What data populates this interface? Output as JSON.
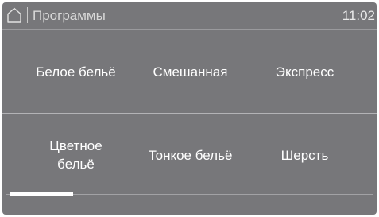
{
  "header": {
    "title": "Программы",
    "clock": "11:02",
    "home_icon": "home-icon"
  },
  "programs": [
    {
      "label": "Белое бельё"
    },
    {
      "label": "Смешанная"
    },
    {
      "label": "Экспресс"
    },
    {
      "label": "Цветное бельё"
    },
    {
      "label": "Тонкое бельё"
    },
    {
      "label": "Шерсть"
    }
  ],
  "scroll": {
    "page_fraction": 0.17
  },
  "colors": {
    "background": "#77777a",
    "text": "#ffffff",
    "indicator": "#ffffff"
  }
}
